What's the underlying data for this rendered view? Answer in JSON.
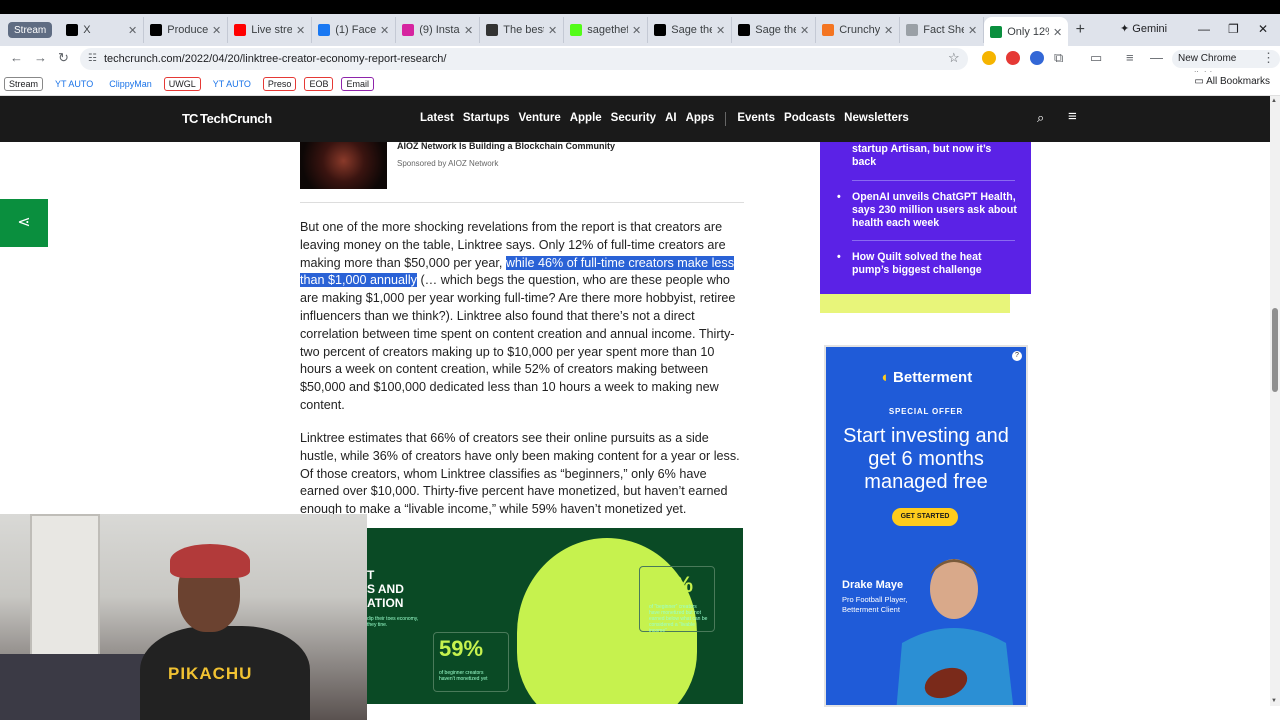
{
  "browser": {
    "tabs": [
      {
        "title": "Stream",
        "color": "#5f6c82"
      },
      {
        "title": "X",
        "color": "#000000"
      },
      {
        "title": "Producer",
        "color": "#000000"
      },
      {
        "title": "Live stream",
        "color": "#ff0000"
      },
      {
        "title": "(1) Facebo",
        "color": "#1877f2"
      },
      {
        "title": "(9) Instagr",
        "color": "#d6249f"
      },
      {
        "title": "The best Ch",
        "color": "#333333"
      },
      {
        "title": "sagethefo",
        "color": "#53fc18"
      },
      {
        "title": "Sage the h",
        "color": "#000000"
      },
      {
        "title": "Sage the h",
        "color": "#000000"
      },
      {
        "title": "Crunchyro",
        "color": "#f47521"
      },
      {
        "title": "Fact Sheet",
        "color": "#9aa0a6"
      },
      {
        "title": "Only 12%",
        "color": "#0a8f3e"
      }
    ],
    "gemini": "Gemini",
    "url": "techcrunch.com/2022/04/20/linktree-creator-economy-report-research/",
    "new_chrome": "New Chrome available",
    "bookmarks": [
      "Stream",
      "YT AUTO",
      "ClippyMan",
      "UWGL",
      "YT AUTO",
      "Preso",
      "EOB",
      "Email"
    ],
    "all_bookmarks": "All Bookmarks"
  },
  "site": {
    "logo": "TechCrunch",
    "nav": [
      "Latest",
      "Startups",
      "Venture",
      "Apple",
      "Security",
      "AI",
      "Apps",
      "Events",
      "Podcasts",
      "Newsletters"
    ]
  },
  "ad": {
    "title": "AIOZ Network Is Building a Blockchain Community",
    "sponsor": "Sponsored by AIOZ Network"
  },
  "article": {
    "p1_a": "But one of the more shocking revelations from the report is that creators are leaving money on the table, Linktree says. Only 12% of full-time creators are making more than $50,000 per year, ",
    "p1_hl": "while 46% of full-time creators make less than $1,000 annually",
    "p1_b": " (… which begs the question, who are these people who are making $1,000 per year working full-time? Are there more hobbyist, retiree influencers than we think?). Linktree also found that there’s not a direct correlation between time spent on content creation and annual income. Thirty-two percent of creators making up to $10,000 per year spent more than 10 hours a week on content creation, while 52% of creators making between $50,000 and $100,000 dedicated less than 10 hours a week to making new content.",
    "p2": "Linktree estimates that 66% of creators see their online pursuits as a side hustle, while 36% of creators have only been making content for a year or less. Of those creators, whom Linktree classifies as “beginners,” only 6% have earned over $10,000. Thirty-five percent have monetized, but haven’t earned enough to make a “livable income,” while 59% haven’t monetized yet."
  },
  "infographic": {
    "left_text": "T\nS AND\nATION",
    "stat_35": "35%",
    "stat_59": "59%",
    "caption_35": "of “beginner” creators have monetized but not earned below what can be considered a “livable income”",
    "caption_59": "of beginner creators haven't monetized yet",
    "left_small": "dip their toes economy, they tine."
  },
  "webcam": {
    "shirt_text": "PIKACHU"
  },
  "rail": {
    "items": [
      "startup Artisan, but now it’s back",
      "OpenAI unveils ChatGPT Health, says 230 million users ask about health each week",
      "How Quilt solved the heat pump’s biggest challenge"
    ]
  },
  "betterment": {
    "logo": "Betterment",
    "special": "SPECIAL OFFER",
    "headline": "Start investing and get 6 months managed free",
    "button": "GET STARTED",
    "name": "Drake Maye",
    "role": "Pro Football Player, Betterment Client"
  }
}
